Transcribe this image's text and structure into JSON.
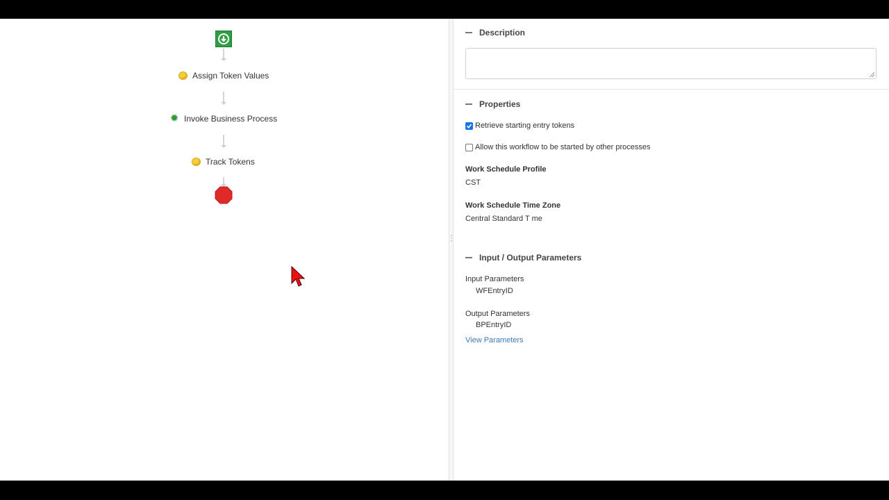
{
  "workflow": {
    "steps": [
      {
        "label": "Assign Token Values",
        "icon": "token-coin-icon"
      },
      {
        "label": "Invoke Business Process",
        "icon": "gear-icon"
      },
      {
        "label": "Track Tokens",
        "icon": "token-coin-icon"
      }
    ],
    "colors": {
      "start": "#2ea043",
      "end": "#e02a2a"
    }
  },
  "panel": {
    "description": {
      "heading": "Description",
      "value": ""
    },
    "properties": {
      "heading": "Properties",
      "retrieve_tokens": {
        "label": "Retrieve starting entry tokens",
        "checked": true
      },
      "allow_started": {
        "label": "Allow this workflow to be started by other processes",
        "checked": false
      },
      "schedule_profile_label": "Work Schedule Profile",
      "schedule_profile_value": "CST",
      "time_zone_label": "Work Schedule Time Zone",
      "time_zone_value": "Central Standard T me"
    },
    "io": {
      "heading": "Input / Output Parameters",
      "input_label": "Input Parameters",
      "input_value": "WFEntryID",
      "output_label": "Output Parameters",
      "output_value": "BPEntryID",
      "view_link": "View Parameters"
    }
  }
}
